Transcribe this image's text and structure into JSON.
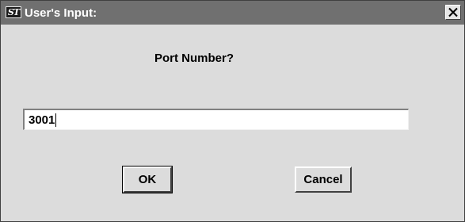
{
  "window": {
    "title": "User's Input:",
    "icon": "app-logo-icon",
    "icon_text": "ST",
    "close_icon": "close-icon"
  },
  "dialog": {
    "prompt": "Port Number?",
    "input_value": "3001",
    "ok_label": "OK",
    "cancel_label": "Cancel"
  },
  "colors": {
    "titlebar": "#707070",
    "window_bg": "#dcdcdc",
    "input_bg": "#ffffff"
  }
}
